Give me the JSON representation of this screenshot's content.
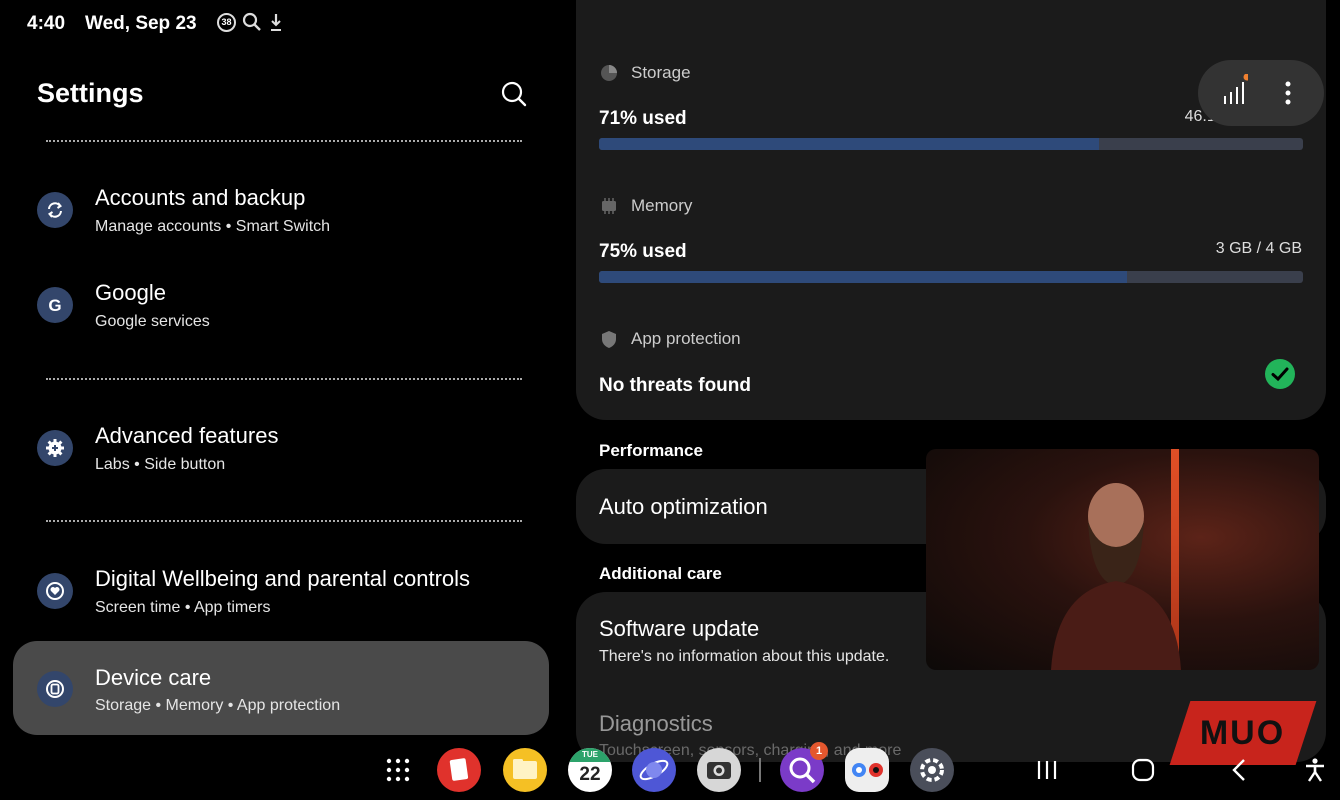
{
  "status_bar": {
    "time": "4:40",
    "date": "Wed, Sep 23",
    "notification_badge": "38",
    "battery": "38"
  },
  "left_panel": {
    "title": "Settings",
    "items": [
      {
        "title": "Accounts and backup",
        "subtitle": "Manage accounts  •  Smart Switch",
        "icon": "sync-icon"
      },
      {
        "title": "Google",
        "subtitle": "Google services",
        "icon": "google-icon"
      },
      {
        "title": "Advanced features",
        "subtitle": "Labs  •  Side button",
        "icon": "gear-plus-icon"
      },
      {
        "title": "Digital Wellbeing and parental controls",
        "subtitle": "Screen time  •  App timers",
        "icon": "wellbeing-icon"
      },
      {
        "title": "Device care",
        "subtitle": "Storage  •  Memory  •  App protection",
        "icon": "device-care-icon",
        "selected": true
      }
    ]
  },
  "device_card": {
    "storage": {
      "label": "Storage",
      "used": "71% used",
      "detail": "46.1 GB / 64 GB",
      "fraction": 0.71
    },
    "memory": {
      "label": "Memory",
      "used": "75% used",
      "detail": "3 GB / 4 GB",
      "fraction": 0.75
    },
    "protection": {
      "label": "App protection",
      "status": "No threats found"
    }
  },
  "performance": {
    "heading": "Performance",
    "auto_optimization": "Auto optimization"
  },
  "additional_care": {
    "heading": "Additional care",
    "software_update": {
      "title": "Software update",
      "subtitle": "There's no information about this update."
    },
    "diagnostics": {
      "title": "Diagnostics",
      "subtitle": "Touchscreen, sensors, charging, and more"
    }
  },
  "watermark": "MUO",
  "taskbar": {
    "calendar_day": "TUE",
    "calendar_date": "22",
    "app_badge": "1"
  },
  "colors": {
    "accent_bar": "#2e4a7a",
    "icon_bg": "#33466b",
    "success": "#22b45a",
    "watermark": "#c8241c"
  }
}
